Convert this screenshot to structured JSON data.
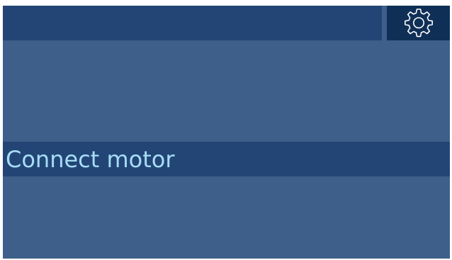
{
  "header": {
    "settings_icon": "gear-icon"
  },
  "status": {
    "message": "Connect motor"
  },
  "colors": {
    "background": "#3d5f8a",
    "bar": "#224576",
    "settings_button": "#0f2f56",
    "text": "#a7dcf5"
  }
}
